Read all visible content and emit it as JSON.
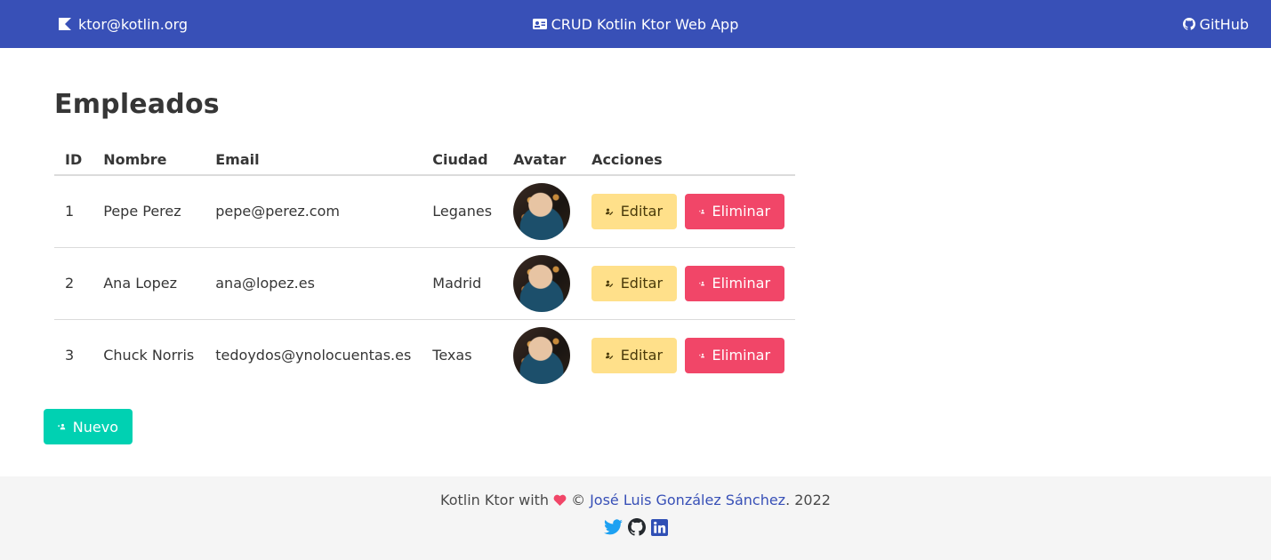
{
  "navbar": {
    "brand_text": "ktor@kotlin.org",
    "center_title": "CRUD Kotlin Ktor Web App",
    "github_label": "GitHub",
    "background": "#3850b7"
  },
  "page": {
    "title": "Empleados"
  },
  "table": {
    "columns": [
      "ID",
      "Nombre",
      "Email",
      "Ciudad",
      "Avatar",
      "Acciones"
    ],
    "rows": [
      {
        "id": "1",
        "nombre": "Pepe Perez",
        "email": "pepe@perez.com",
        "ciudad": "Leganes"
      },
      {
        "id": "2",
        "nombre": "Ana Lopez",
        "email": "ana@lopez.es",
        "ciudad": "Madrid"
      },
      {
        "id": "3",
        "nombre": "Chuck Norris",
        "email": "tedoydos@ynolocuentas.es",
        "ciudad": "Texas"
      }
    ],
    "edit_label": "Editar",
    "delete_label": "Eliminar",
    "edit_color": "#ffe08a",
    "delete_color": "#f14668"
  },
  "actions": {
    "new_label": "Nuevo",
    "new_color": "#00d1b2"
  },
  "footer": {
    "prefix": "Kotlin Ktor with",
    "copyright": "©",
    "author": "José Luis González Sánchez",
    "year": ". 2022",
    "icons": [
      "heart-icon",
      "twitter-icon",
      "github-icon",
      "linkedin-icon"
    ]
  }
}
